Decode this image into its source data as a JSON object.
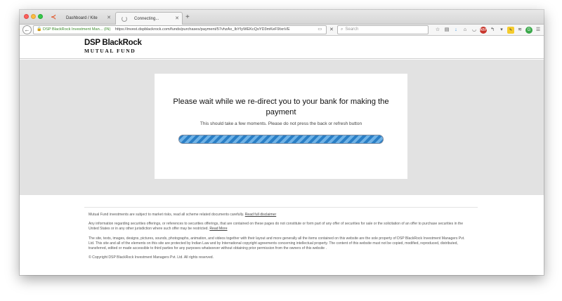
{
  "browser": {
    "tabs": [
      {
        "label": "Dashboard / Kite",
        "active": false
      },
      {
        "label": "Connecting...",
        "active": true
      }
    ],
    "url": {
      "identity": "DSP BlackRock Investment Man... (IN)",
      "address": "https://invest.dspblackrock.com/funds/purchases/payment/57vhzAx_IbYIyWEKcQsYD3mKeF9IxnVE"
    },
    "search_placeholder": "Search",
    "colors": {
      "download": "#2b8ae0",
      "adblock": "#c8362c",
      "extension_green": "#3aa84a"
    }
  },
  "site": {
    "logo_top": "DSP BlackRock",
    "logo_bottom": "MUTUAL FUND"
  },
  "redirect": {
    "heading": "Please wait while we re-direct you to your bank for making the payment",
    "subtext": "This should take a few moments. Please do not press the back or refresh button",
    "progress_color": "#2a7fc6"
  },
  "footer": {
    "disclaimer_text": "Mutual Fund investments are subject to market risks, read all scheme related documents carefully.",
    "disclaimer_link": "Read full disclaimer",
    "offer_text": "Any information regarding securities offerings, or references to securities offerings, that are contained on these pages do not constitute or form part of any offer of securities for sale or the solicitation of an offer to purchase securities in the United States or in any other jurisdiction where such offer may be restricted.",
    "offer_link": "Read More",
    "ip_text": "The site, texts, images, designs, pictures, sounds, photographs, animation, and videos together with their layout and more generally all the items contained on this website are the sole property of DSP BlackRock Investment Managers Pvt. Ltd. This site and all of the elements on this site are protected by Indian Law and by International copyright agreements concerning intellectual property. The content of this website must not be copied, modified, reproduced, distributed, transferred, edited or made accessible to third parties for any purposes whatsoever without obtaining prior permission from the owners of this website .",
    "copyright": "© Copyright DSP BlackRock Investment Managers Pvt. Ltd. All rights reserved."
  }
}
